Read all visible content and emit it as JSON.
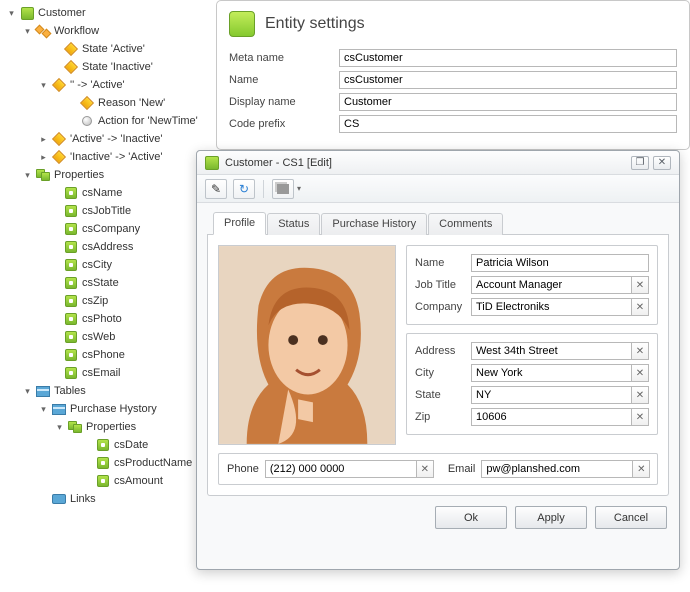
{
  "tree": {
    "root": "Customer",
    "workflow": "Workflow",
    "state_active": "State 'Active'",
    "state_inactive": "State 'Inactive'",
    "t_to_active": "'' -> 'Active'",
    "reason_new": "Reason 'New'",
    "action_newtime": "Action for 'NewTime'",
    "t_active_inactive": "'Active' -> 'Inactive'",
    "t_inactive_active": "'Inactive' -> 'Active'",
    "properties": "Properties",
    "p": {
      "name": "csName",
      "jobtitle": "csJobTitle",
      "company": "csCompany",
      "address": "csAddress",
      "city": "csCity",
      "state": "csState",
      "zip": "csZip",
      "photo": "csPhoto",
      "web": "csWeb",
      "phone": "csPhone",
      "email": "csEmail"
    },
    "tables": "Tables",
    "purchase_history": "Purchase Hystory",
    "ph_props": "Properties",
    "ph": {
      "date": "csDate",
      "product": "csProductName",
      "amount": "csAmount"
    },
    "links": "Links"
  },
  "entity_settings": {
    "title": "Entity settings",
    "meta_name_label": "Meta name",
    "meta_name": "csCustomer",
    "name_label": "Name",
    "name": "csCustomer",
    "display_name_label": "Display name",
    "display_name": "Customer",
    "code_prefix_label": "Code prefix",
    "code_prefix": "CS"
  },
  "dialog": {
    "title": "Customer - CS1 [Edit]",
    "tabs": {
      "profile": "Profile",
      "status": "Status",
      "purchase": "Purchase History",
      "comments": "Comments"
    },
    "labels": {
      "name": "Name",
      "jobtitle": "Job Title",
      "company": "Company",
      "address": "Address",
      "city": "City",
      "state": "State",
      "zip": "Zip",
      "phone": "Phone",
      "email": "Email"
    },
    "values": {
      "name": "Patricia Wilson",
      "jobtitle": "Account Manager",
      "company": "TiD Electroniks",
      "address": "West 34th Street",
      "city": "New York",
      "state": "NY",
      "zip": "10606",
      "phone": "(212) 000 0000",
      "email": "pw@planshed.com"
    },
    "buttons": {
      "ok": "Ok",
      "apply": "Apply",
      "cancel": "Cancel"
    }
  }
}
